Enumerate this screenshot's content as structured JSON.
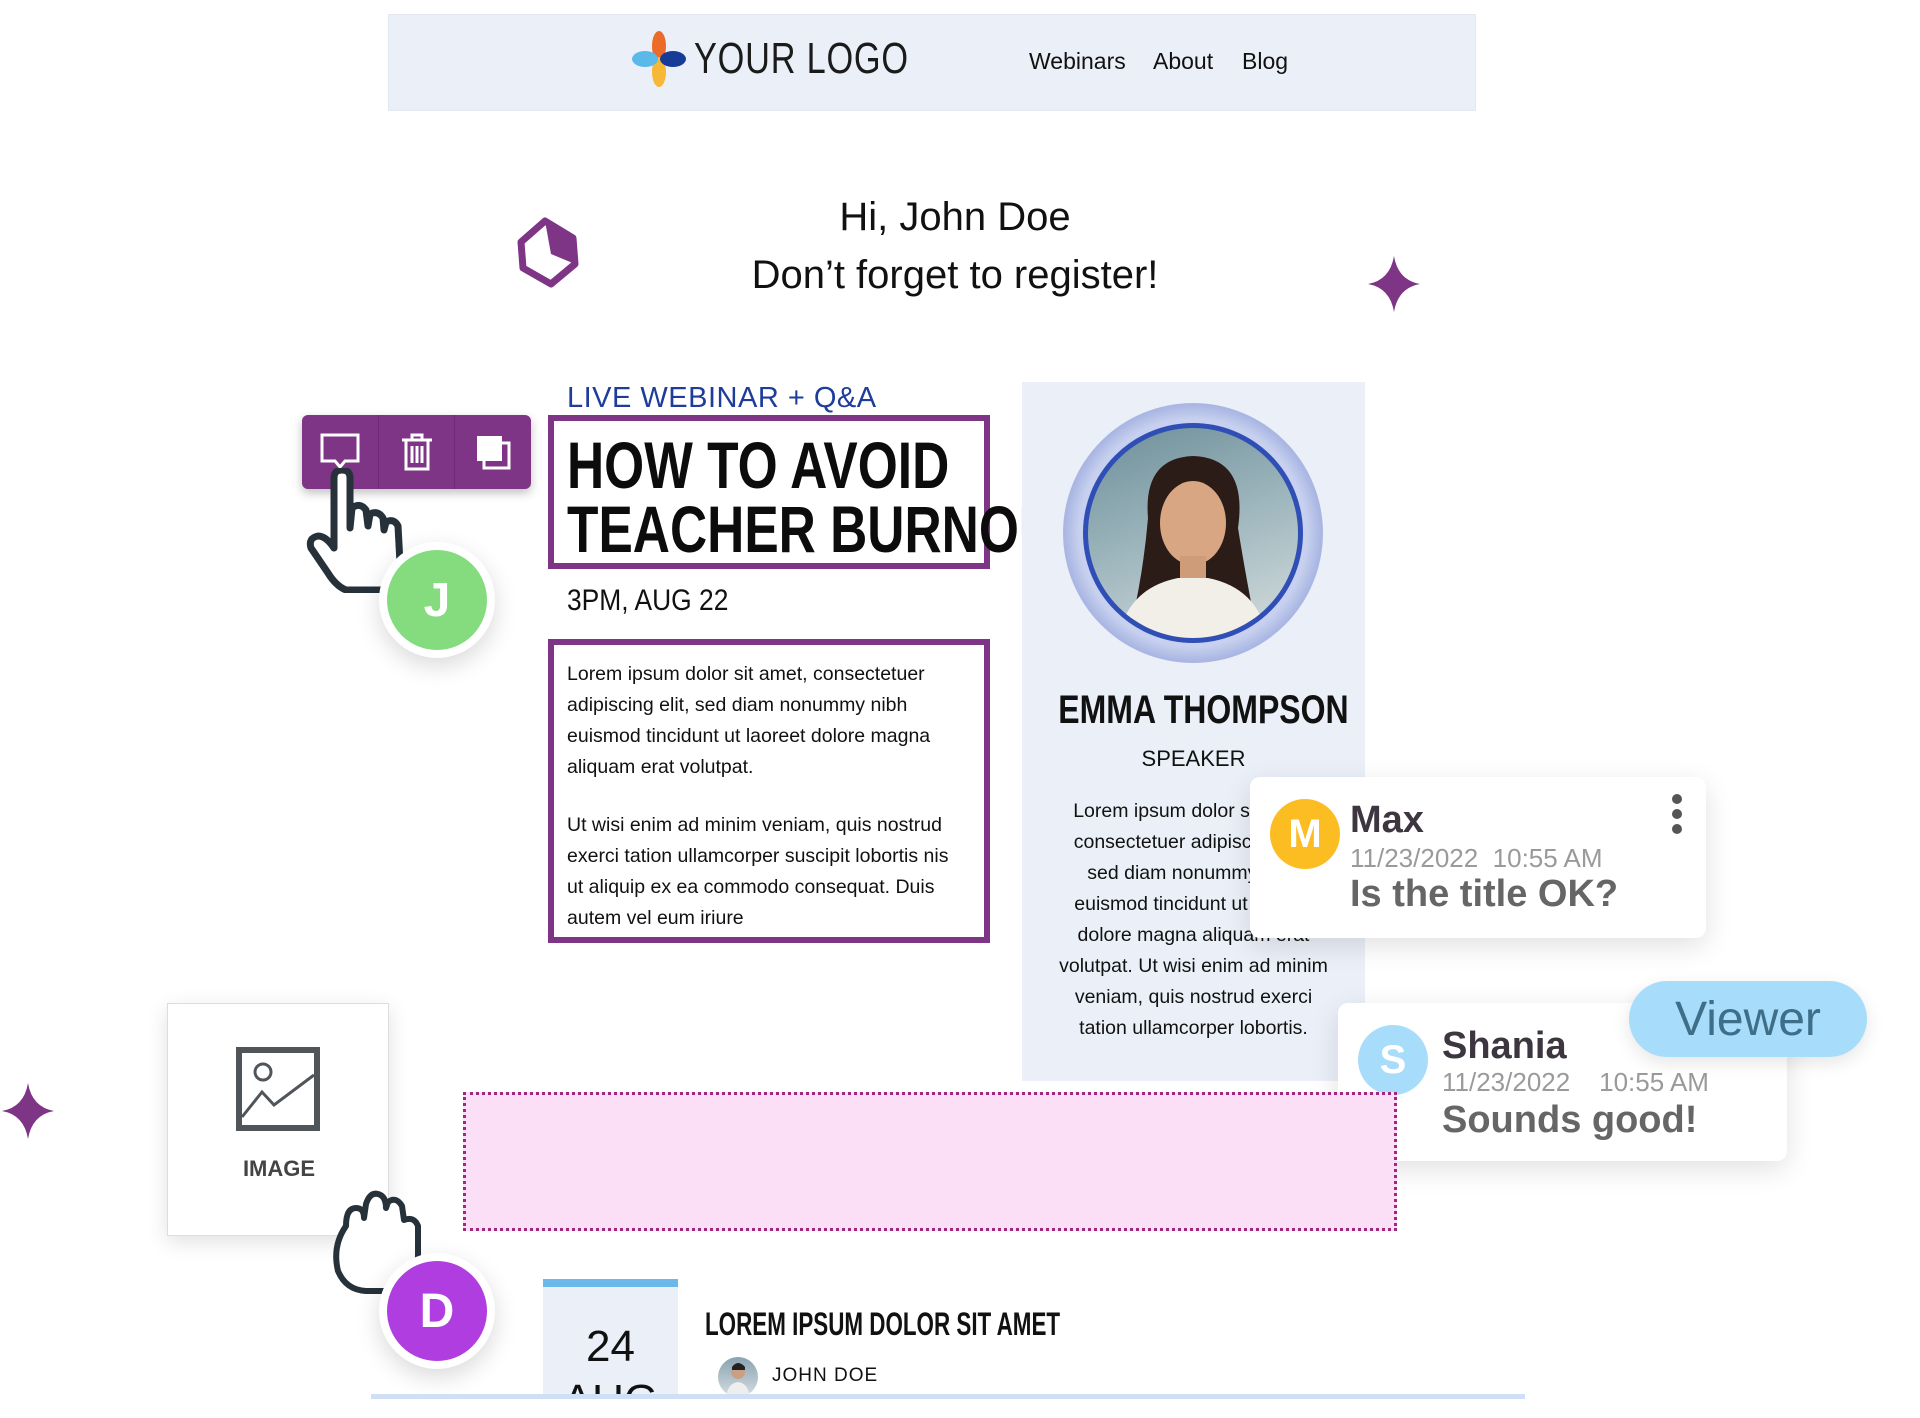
{
  "header": {
    "logo_text": "YOUR LOGO",
    "nav": [
      "Webinars",
      "About",
      "Blog"
    ]
  },
  "greeting": {
    "line1": "Hi, John Doe",
    "line2": "Don’t forget to register!"
  },
  "webinar": {
    "tag": "LIVE WEBINAR + Q&A",
    "title_lines": [
      "HOW TO AVOID",
      "TEACHER BURNOUT"
    ],
    "datetime": "3PM, AUG 22",
    "body": [
      [
        "Lorem ipsum dolor sit amet, consectetuer",
        "adipiscing elit, sed diam nonummy nibh",
        "euismod tincidunt ut laoreet dolore magna",
        "aliquam erat volutpat."
      ],
      [
        "Ut wisi enim ad minim veniam, quis nostrud",
        "exerci tation ullamcorper suscipit lobortis nis",
        "ut aliquip ex ea commodo consequat. Duis",
        "autem vel eum iriure"
      ]
    ]
  },
  "speaker": {
    "name": "EMMA THOMPSON",
    "role": "SPEAKER",
    "bio_lines": [
      "Lorem ipsum dolor sit amet,",
      "consectetuer adipiscing elit,",
      "sed diam nonummy nibh",
      "euismod tincidunt ut laoreet",
      "dolore magna aliquam erat",
      "volutpat. Ut wisi enim ad minim",
      "veniam, quis nostrud exerci",
      "tation ullamcorper lobortis."
    ]
  },
  "toolbar": {
    "icons": [
      "comment-icon",
      "trash-icon",
      "duplicate-icon"
    ]
  },
  "collaborators": {
    "j": {
      "initial": "J",
      "color": "#84dc7e"
    },
    "d": {
      "initial": "D",
      "color": "#b03de0"
    }
  },
  "comments": [
    {
      "initial": "M",
      "color": "#fbbd22",
      "name": "Max",
      "date": "11/23/2022",
      "time": "10:55 AM",
      "message": "Is the title OK?"
    },
    {
      "initial": "S",
      "color": "#a7dcfb",
      "name": "Shania",
      "date": "11/23/2022",
      "time": "10:55 AM",
      "message": "Sounds good!"
    }
  ],
  "role_badge": "Viewer",
  "image_block": {
    "label": "IMAGE"
  },
  "event": {
    "day": "24",
    "month": "AUG",
    "title": "LOREM IPSUM DOLOR SIT AMET",
    "author": "JOHN DOE"
  },
  "colors": {
    "accent_purple": "#7f3586",
    "header_bg": "#ebf0f8",
    "link_blue": "#1e3c9a",
    "drop_zone": "#fadff6"
  }
}
